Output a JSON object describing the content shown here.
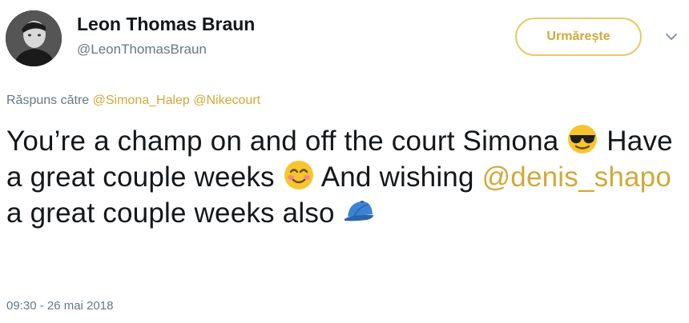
{
  "user": {
    "display_name": "Leon Thomas Braun",
    "handle": "@LeonThomasBraun"
  },
  "follow_button": {
    "label": "Urmărește"
  },
  "reply": {
    "prefix": "Răspuns către",
    "mentions": [
      "@Simona_Halep",
      "@Nikecourt"
    ]
  },
  "tweet": {
    "part1": "You’re a champ on and off the court Simona",
    "part2": "Have a great couple weeks",
    "part3": "And wishing",
    "mention": "@denis_shapo",
    "part4": "a great couple weeks also",
    "emojis": [
      "sunglasses-face-emoji",
      "smiling-face-emoji",
      "blue-cap-emoji"
    ]
  },
  "timestamp": "09:30 - 26 mai 2018",
  "colors": {
    "accent": "#d1a93a",
    "text": "#14171a",
    "secondary": "#657786"
  }
}
